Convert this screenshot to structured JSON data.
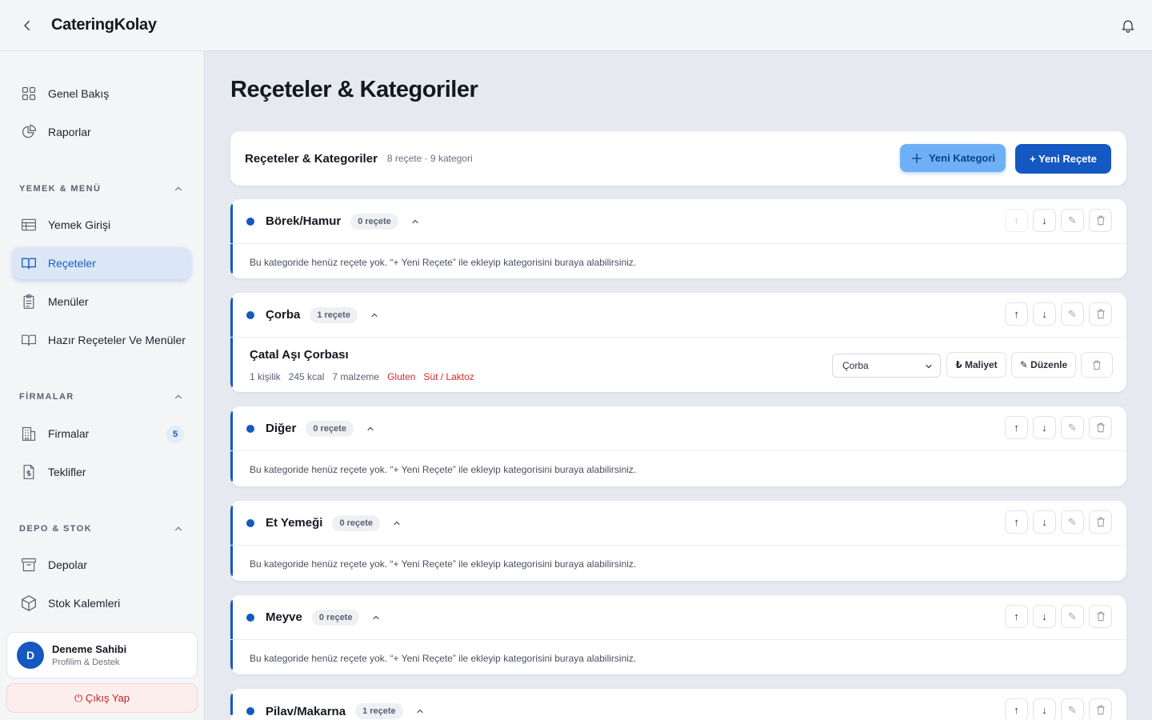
{
  "app": {
    "brand": "CateringKolay"
  },
  "sidebar": {
    "top_items": [
      {
        "label": "Genel Bakış",
        "icon": "grid-icon"
      },
      {
        "label": "Raporlar",
        "icon": "pie-chart-icon"
      }
    ],
    "sections": [
      {
        "title": "YEMEK & MENÜ",
        "items": [
          {
            "label": "Yemek Girişi",
            "icon": "table-icon"
          },
          {
            "label": "Reçeteler",
            "icon": "book-open-icon",
            "active": true
          },
          {
            "label": "Menüler",
            "icon": "clipboard-icon"
          },
          {
            "label": "Hazır Reçeteler Ve Menüler",
            "icon": "book-icon"
          }
        ]
      },
      {
        "title": "FİRMALAR",
        "items": [
          {
            "label": "Firmalar",
            "icon": "building-icon",
            "badge": "5"
          },
          {
            "label": "Teklifler",
            "icon": "invoice-icon"
          }
        ]
      },
      {
        "title": "DEPO & STOK",
        "items": [
          {
            "label": "Depolar",
            "icon": "archive-icon"
          },
          {
            "label": "Stok Kalemleri",
            "icon": "box-icon"
          }
        ]
      }
    ],
    "user": {
      "initial": "D",
      "name": "Deneme Sahibi",
      "subtitle": "Profilim & Destek"
    },
    "logout_label": "⏻ Çıkış Yap"
  },
  "main": {
    "page_title": "Reçeteler & Kategoriler",
    "header": {
      "title": "Reçeteler & Kategoriler",
      "summary": "8 reçete · 9 kategori",
      "new_category_label": "Yeni Kategori",
      "new_recipe_label": "+ Yeni Reçete"
    },
    "empty_message": "Bu kategoride henüz reçete yok. “+ Yeni Reçete” ile ekleyip kategorisini buraya alabilirsiniz.",
    "categories": [
      {
        "name": "Börek/Hamur",
        "count": "0 reçete"
      },
      {
        "name": "Çorba",
        "count": "1 reçete"
      },
      {
        "name": "Diğer",
        "count": "0 reçete"
      },
      {
        "name": "Et Yemeği",
        "count": "0 reçete"
      },
      {
        "name": "Meyve",
        "count": "0 reçete"
      },
      {
        "name": "Pilav/Makarna",
        "count": "1 reçete"
      }
    ],
    "recipe": {
      "name": "Çatal Aşı Çorbası",
      "servings": "1 kişilik",
      "kcal": "245 kcal",
      "ingredients": "7 malzeme",
      "allergens": [
        "Gluten",
        "Süt / Laktoz"
      ],
      "category_select": "Çorba",
      "cost_label": "₺ Maliyet",
      "edit_label": "✎ Düzenle"
    }
  },
  "colors": {
    "primary": "#1458c2",
    "primary_light": "#6db0f5",
    "allergen": "#d42a2a",
    "logout": "#c22222"
  }
}
